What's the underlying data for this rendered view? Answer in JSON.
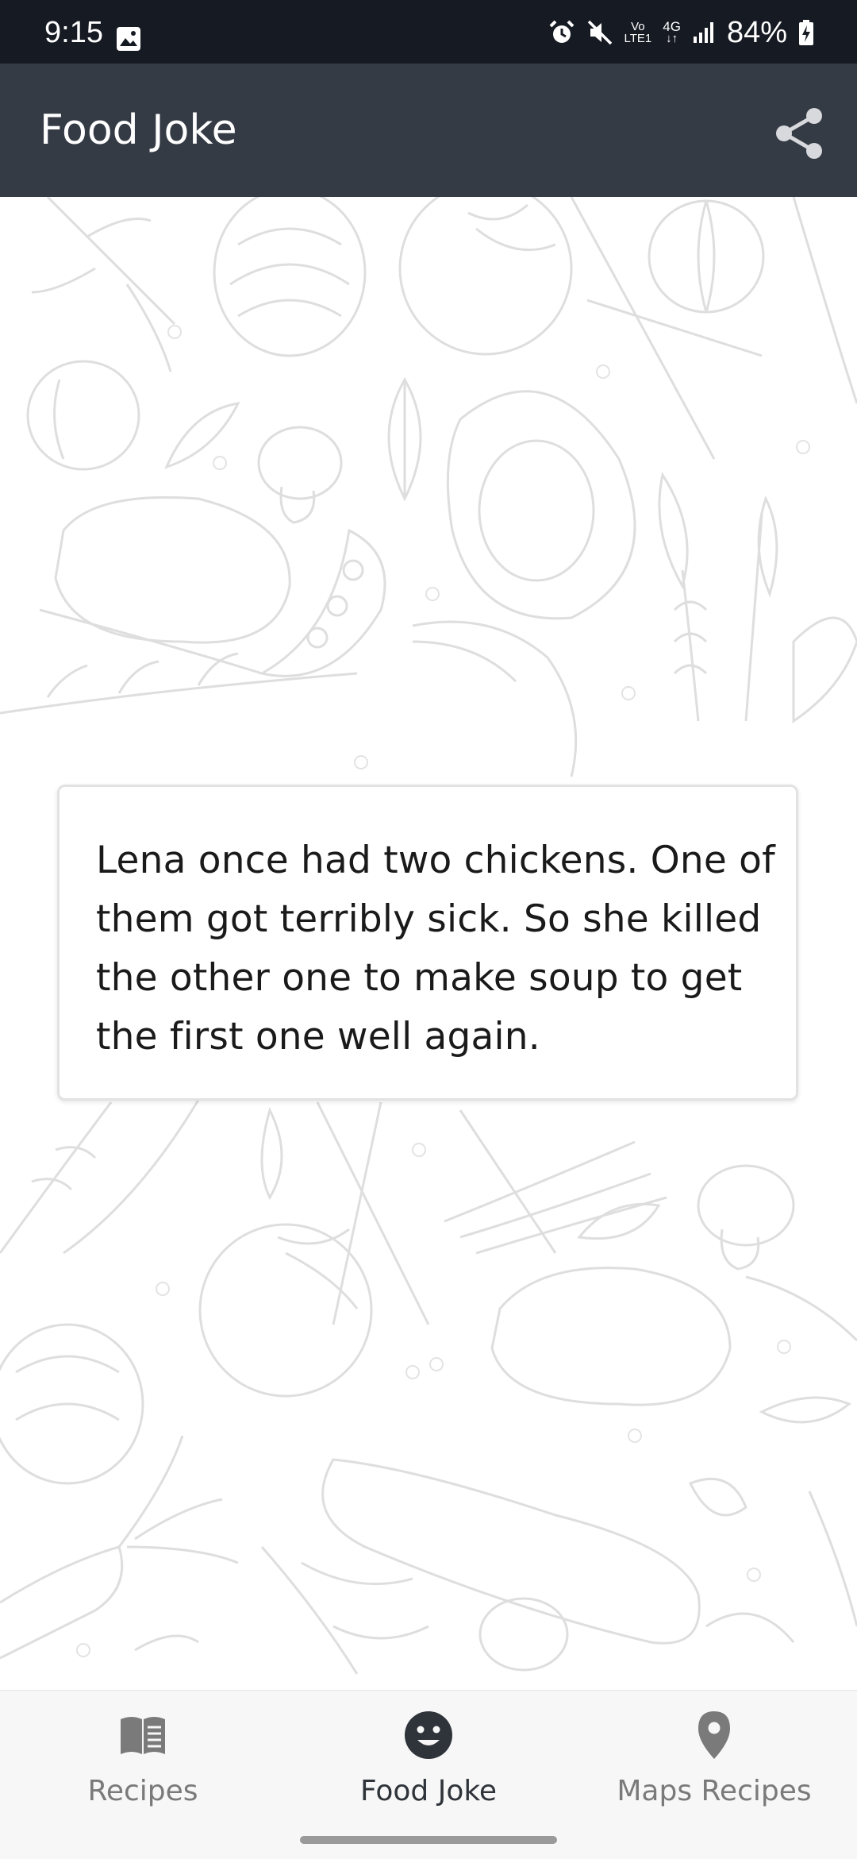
{
  "status_bar": {
    "time": "9:15",
    "battery": "84%",
    "network_top": "Vo",
    "network_bottom": "LTE1",
    "network_type": "4G",
    "icons": [
      "gallery-icon",
      "alarm-icon",
      "mute-icon",
      "signal-icon",
      "battery-charging-icon"
    ]
  },
  "app_bar": {
    "title": "Food Joke",
    "share_icon": "share-icon"
  },
  "joke": {
    "text": "Lena once had two chickens. One of them got terribly sick. So she killed the other one to make soup to get the first one well again."
  },
  "bottom_nav": {
    "items": [
      {
        "label": "Recipes",
        "icon": "book-icon",
        "active": false
      },
      {
        "label": "Food Joke",
        "icon": "smiley-icon",
        "active": true
      },
      {
        "label": "Maps Recipes",
        "icon": "location-pin-icon",
        "active": false
      }
    ]
  },
  "colors": {
    "status_bar": "#161a22",
    "app_bar": "#343b44",
    "active_nav": "#2f343a",
    "inactive_nav": "#7a7a7a"
  }
}
